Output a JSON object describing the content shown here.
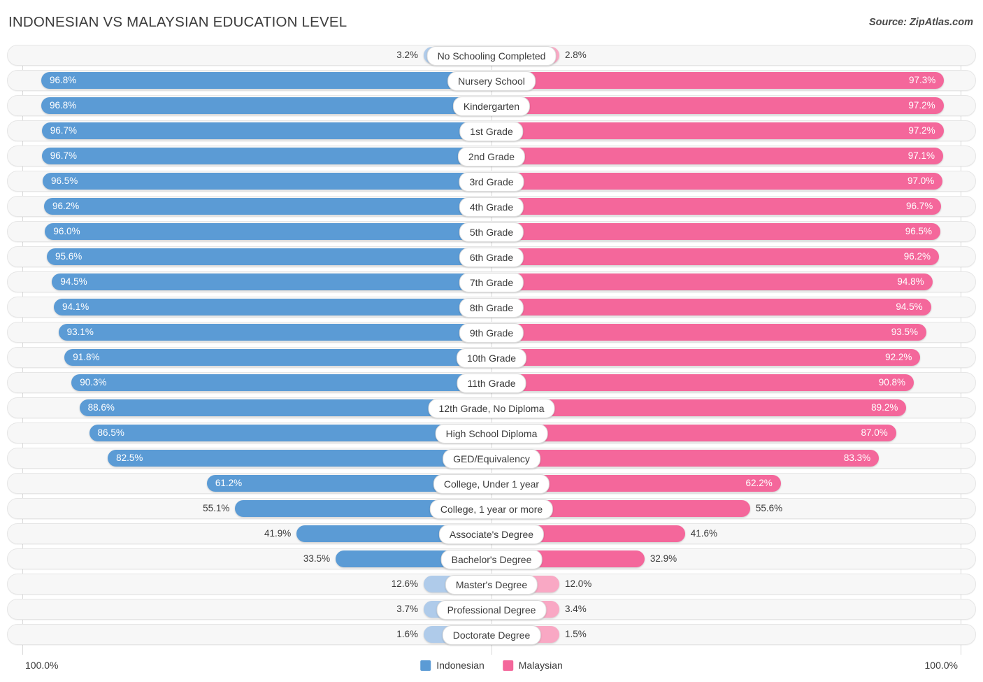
{
  "header": {
    "title": "INDONESIAN VS MALAYSIAN EDUCATION LEVEL",
    "source": "Source: ZipAtlas.com"
  },
  "axis": {
    "left_max": "100.0%",
    "right_max": "100.0%"
  },
  "legend": {
    "items": [
      {
        "label": "Indonesian",
        "color": "#5B9BD5"
      },
      {
        "label": "Malaysian",
        "color": "#F4679B"
      }
    ]
  },
  "colors": {
    "left_strong": "#5B9BD5",
    "left_light": "#AFCBEA",
    "right_strong": "#F4679B",
    "right_light": "#F9A8C4",
    "track": "#F7F7F7",
    "gridline": "#D9D9D9"
  },
  "chart_data": {
    "type": "bar",
    "title": "INDONESIAN VS MALAYSIAN EDUCATION LEVEL",
    "orientation": "horizontal-diverging",
    "xlabel": "",
    "ylabel": "",
    "xlim": [
      0,
      100
    ],
    "grid": true,
    "legend_position": "bottom-center",
    "categories": [
      "No Schooling Completed",
      "Nursery School",
      "Kindergarten",
      "1st Grade",
      "2nd Grade",
      "3rd Grade",
      "4th Grade",
      "5th Grade",
      "6th Grade",
      "7th Grade",
      "8th Grade",
      "9th Grade",
      "10th Grade",
      "11th Grade",
      "12th Grade, No Diploma",
      "High School Diploma",
      "GED/Equivalency",
      "College, Under 1 year",
      "College, 1 year or more",
      "Associate's Degree",
      "Bachelor's Degree",
      "Master's Degree",
      "Professional Degree",
      "Doctorate Degree"
    ],
    "series": [
      {
        "name": "Indonesian",
        "color": "#5B9BD5",
        "values": [
          3.2,
          96.8,
          96.8,
          96.7,
          96.7,
          96.5,
          96.2,
          96.0,
          95.6,
          94.5,
          94.1,
          93.1,
          91.8,
          90.3,
          88.6,
          86.5,
          82.5,
          61.2,
          55.1,
          41.9,
          33.5,
          12.6,
          3.7,
          1.6
        ]
      },
      {
        "name": "Malaysian",
        "color": "#F4679B",
        "values": [
          2.8,
          97.3,
          97.2,
          97.2,
          97.1,
          97.0,
          96.7,
          96.5,
          96.2,
          94.8,
          94.5,
          93.5,
          92.2,
          90.8,
          89.2,
          87.0,
          83.3,
          62.2,
          55.6,
          41.6,
          32.9,
          12.0,
          3.4,
          1.5
        ]
      }
    ]
  },
  "rows": [
    {
      "label": "No Schooling Completed",
      "left": {
        "value": 3.2,
        "text": "3.2%",
        "inside": false,
        "light": true
      },
      "right": {
        "value": 2.8,
        "text": "2.8%",
        "inside": false,
        "light": true
      }
    },
    {
      "label": "Nursery School",
      "left": {
        "value": 96.8,
        "text": "96.8%",
        "inside": true,
        "light": false
      },
      "right": {
        "value": 97.3,
        "text": "97.3%",
        "inside": true,
        "light": false
      }
    },
    {
      "label": "Kindergarten",
      "left": {
        "value": 96.8,
        "text": "96.8%",
        "inside": true,
        "light": false
      },
      "right": {
        "value": 97.2,
        "text": "97.2%",
        "inside": true,
        "light": false
      }
    },
    {
      "label": "1st Grade",
      "left": {
        "value": 96.7,
        "text": "96.7%",
        "inside": true,
        "light": false
      },
      "right": {
        "value": 97.2,
        "text": "97.2%",
        "inside": true,
        "light": false
      }
    },
    {
      "label": "2nd Grade",
      "left": {
        "value": 96.7,
        "text": "96.7%",
        "inside": true,
        "light": false
      },
      "right": {
        "value": 97.1,
        "text": "97.1%",
        "inside": true,
        "light": false
      }
    },
    {
      "label": "3rd Grade",
      "left": {
        "value": 96.5,
        "text": "96.5%",
        "inside": true,
        "light": false
      },
      "right": {
        "value": 97.0,
        "text": "97.0%",
        "inside": true,
        "light": false
      }
    },
    {
      "label": "4th Grade",
      "left": {
        "value": 96.2,
        "text": "96.2%",
        "inside": true,
        "light": false
      },
      "right": {
        "value": 96.7,
        "text": "96.7%",
        "inside": true,
        "light": false
      }
    },
    {
      "label": "5th Grade",
      "left": {
        "value": 96.0,
        "text": "96.0%",
        "inside": true,
        "light": false
      },
      "right": {
        "value": 96.5,
        "text": "96.5%",
        "inside": true,
        "light": false
      }
    },
    {
      "label": "6th Grade",
      "left": {
        "value": 95.6,
        "text": "95.6%",
        "inside": true,
        "light": false
      },
      "right": {
        "value": 96.2,
        "text": "96.2%",
        "inside": true,
        "light": false
      }
    },
    {
      "label": "7th Grade",
      "left": {
        "value": 94.5,
        "text": "94.5%",
        "inside": true,
        "light": false
      },
      "right": {
        "value": 94.8,
        "text": "94.8%",
        "inside": true,
        "light": false
      }
    },
    {
      "label": "8th Grade",
      "left": {
        "value": 94.1,
        "text": "94.1%",
        "inside": true,
        "light": false
      },
      "right": {
        "value": 94.5,
        "text": "94.5%",
        "inside": true,
        "light": false
      }
    },
    {
      "label": "9th Grade",
      "left": {
        "value": 93.1,
        "text": "93.1%",
        "inside": true,
        "light": false
      },
      "right": {
        "value": 93.5,
        "text": "93.5%",
        "inside": true,
        "light": false
      }
    },
    {
      "label": "10th Grade",
      "left": {
        "value": 91.8,
        "text": "91.8%",
        "inside": true,
        "light": false
      },
      "right": {
        "value": 92.2,
        "text": "92.2%",
        "inside": true,
        "light": false
      }
    },
    {
      "label": "11th Grade",
      "left": {
        "value": 90.3,
        "text": "90.3%",
        "inside": true,
        "light": false
      },
      "right": {
        "value": 90.8,
        "text": "90.8%",
        "inside": true,
        "light": false
      }
    },
    {
      "label": "12th Grade, No Diploma",
      "left": {
        "value": 88.6,
        "text": "88.6%",
        "inside": true,
        "light": false
      },
      "right": {
        "value": 89.2,
        "text": "89.2%",
        "inside": true,
        "light": false
      }
    },
    {
      "label": "High School Diploma",
      "left": {
        "value": 86.5,
        "text": "86.5%",
        "inside": true,
        "light": false
      },
      "right": {
        "value": 87.0,
        "text": "87.0%",
        "inside": true,
        "light": false
      }
    },
    {
      "label": "GED/Equivalency",
      "left": {
        "value": 82.5,
        "text": "82.5%",
        "inside": true,
        "light": false
      },
      "right": {
        "value": 83.3,
        "text": "83.3%",
        "inside": true,
        "light": false
      }
    },
    {
      "label": "College, Under 1 year",
      "left": {
        "value": 61.2,
        "text": "61.2%",
        "inside": true,
        "light": false
      },
      "right": {
        "value": 62.2,
        "text": "62.2%",
        "inside": true,
        "light": false
      }
    },
    {
      "label": "College, 1 year or more",
      "left": {
        "value": 55.1,
        "text": "55.1%",
        "inside": false,
        "light": false
      },
      "right": {
        "value": 55.6,
        "text": "55.6%",
        "inside": false,
        "light": false
      }
    },
    {
      "label": "Associate's Degree",
      "left": {
        "value": 41.9,
        "text": "41.9%",
        "inside": false,
        "light": false
      },
      "right": {
        "value": 41.6,
        "text": "41.6%",
        "inside": false,
        "light": false
      }
    },
    {
      "label": "Bachelor's Degree",
      "left": {
        "value": 33.5,
        "text": "33.5%",
        "inside": false,
        "light": false
      },
      "right": {
        "value": 32.9,
        "text": "32.9%",
        "inside": false,
        "light": false
      }
    },
    {
      "label": "Master's Degree",
      "left": {
        "value": 12.6,
        "text": "12.6%",
        "inside": false,
        "light": true
      },
      "right": {
        "value": 12.0,
        "text": "12.0%",
        "inside": false,
        "light": true
      }
    },
    {
      "label": "Professional Degree",
      "left": {
        "value": 3.7,
        "text": "3.7%",
        "inside": false,
        "light": true
      },
      "right": {
        "value": 3.4,
        "text": "3.4%",
        "inside": false,
        "light": true
      }
    },
    {
      "label": "Doctorate Degree",
      "left": {
        "value": 1.6,
        "text": "1.6%",
        "inside": false,
        "light": true
      },
      "right": {
        "value": 1.5,
        "text": "1.5%",
        "inside": false,
        "light": true
      }
    }
  ]
}
